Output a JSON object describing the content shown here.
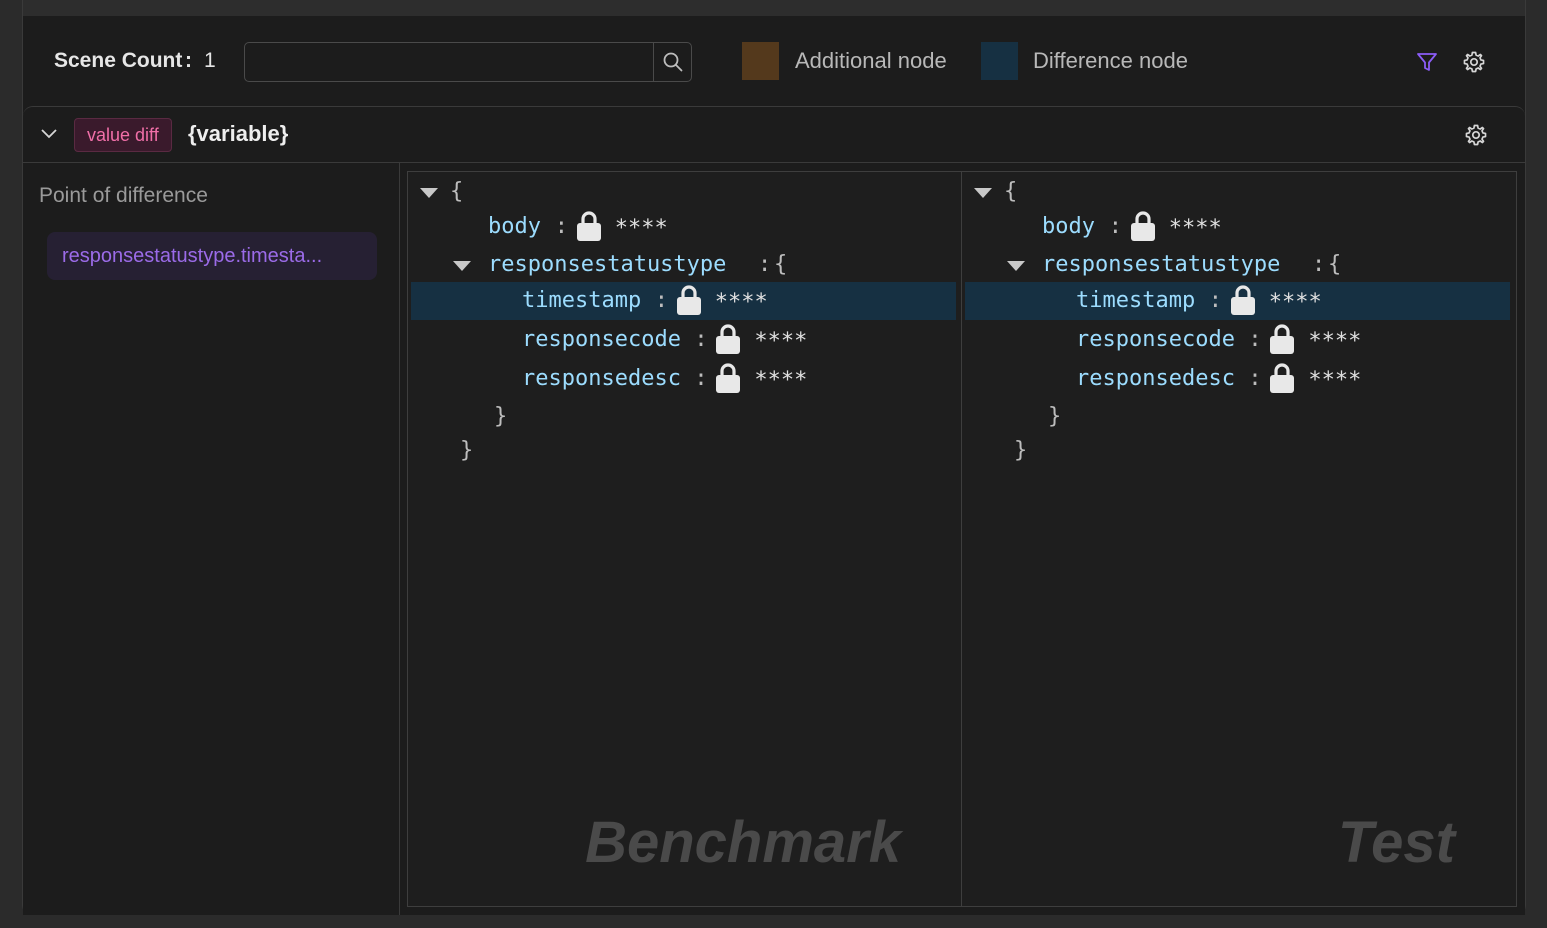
{
  "toolbar": {
    "scene_count_label": "Scene Count",
    "scene_count_colon": ":",
    "scene_count_value": "1",
    "search_placeholder": "",
    "legend": [
      {
        "label": "Additional node",
        "color": "#54391c"
      },
      {
        "label": "Difference node",
        "color": "#163042"
      }
    ],
    "filter_icon": "filter-icon",
    "settings_icon": "gear-icon"
  },
  "card": {
    "tag": "value diff",
    "title": "{variable}",
    "settings_icon": "gear-icon"
  },
  "sidebar": {
    "title": "Point of difference",
    "items": [
      "responsestatustype.timesta..."
    ]
  },
  "panes": [
    {
      "watermark": "Benchmark",
      "open_brace": "{",
      "fields": {
        "body": {
          "key": "body",
          "value": "****"
        },
        "group": {
          "key": "responsestatustype",
          "brace": "{"
        },
        "children": [
          {
            "key": "timestamp",
            "value": "****",
            "highlight": true
          },
          {
            "key": "responsecode",
            "value": "****",
            "highlight": false
          },
          {
            "key": "responsedesc",
            "value": "****",
            "highlight": false
          }
        ]
      },
      "close_inner": "}",
      "close_outer": "}"
    },
    {
      "watermark": "Test",
      "open_brace": "{",
      "fields": {
        "body": {
          "key": "body",
          "value": "****"
        },
        "group": {
          "key": "responsestatustype",
          "brace": "{"
        },
        "children": [
          {
            "key": "timestamp",
            "value": "****",
            "highlight": true
          },
          {
            "key": "responsecode",
            "value": "****",
            "highlight": false
          },
          {
            "key": "responsedesc",
            "value": "****",
            "highlight": false
          }
        ]
      },
      "close_inner": "}",
      "close_outer": "}"
    }
  ],
  "colon": ":"
}
